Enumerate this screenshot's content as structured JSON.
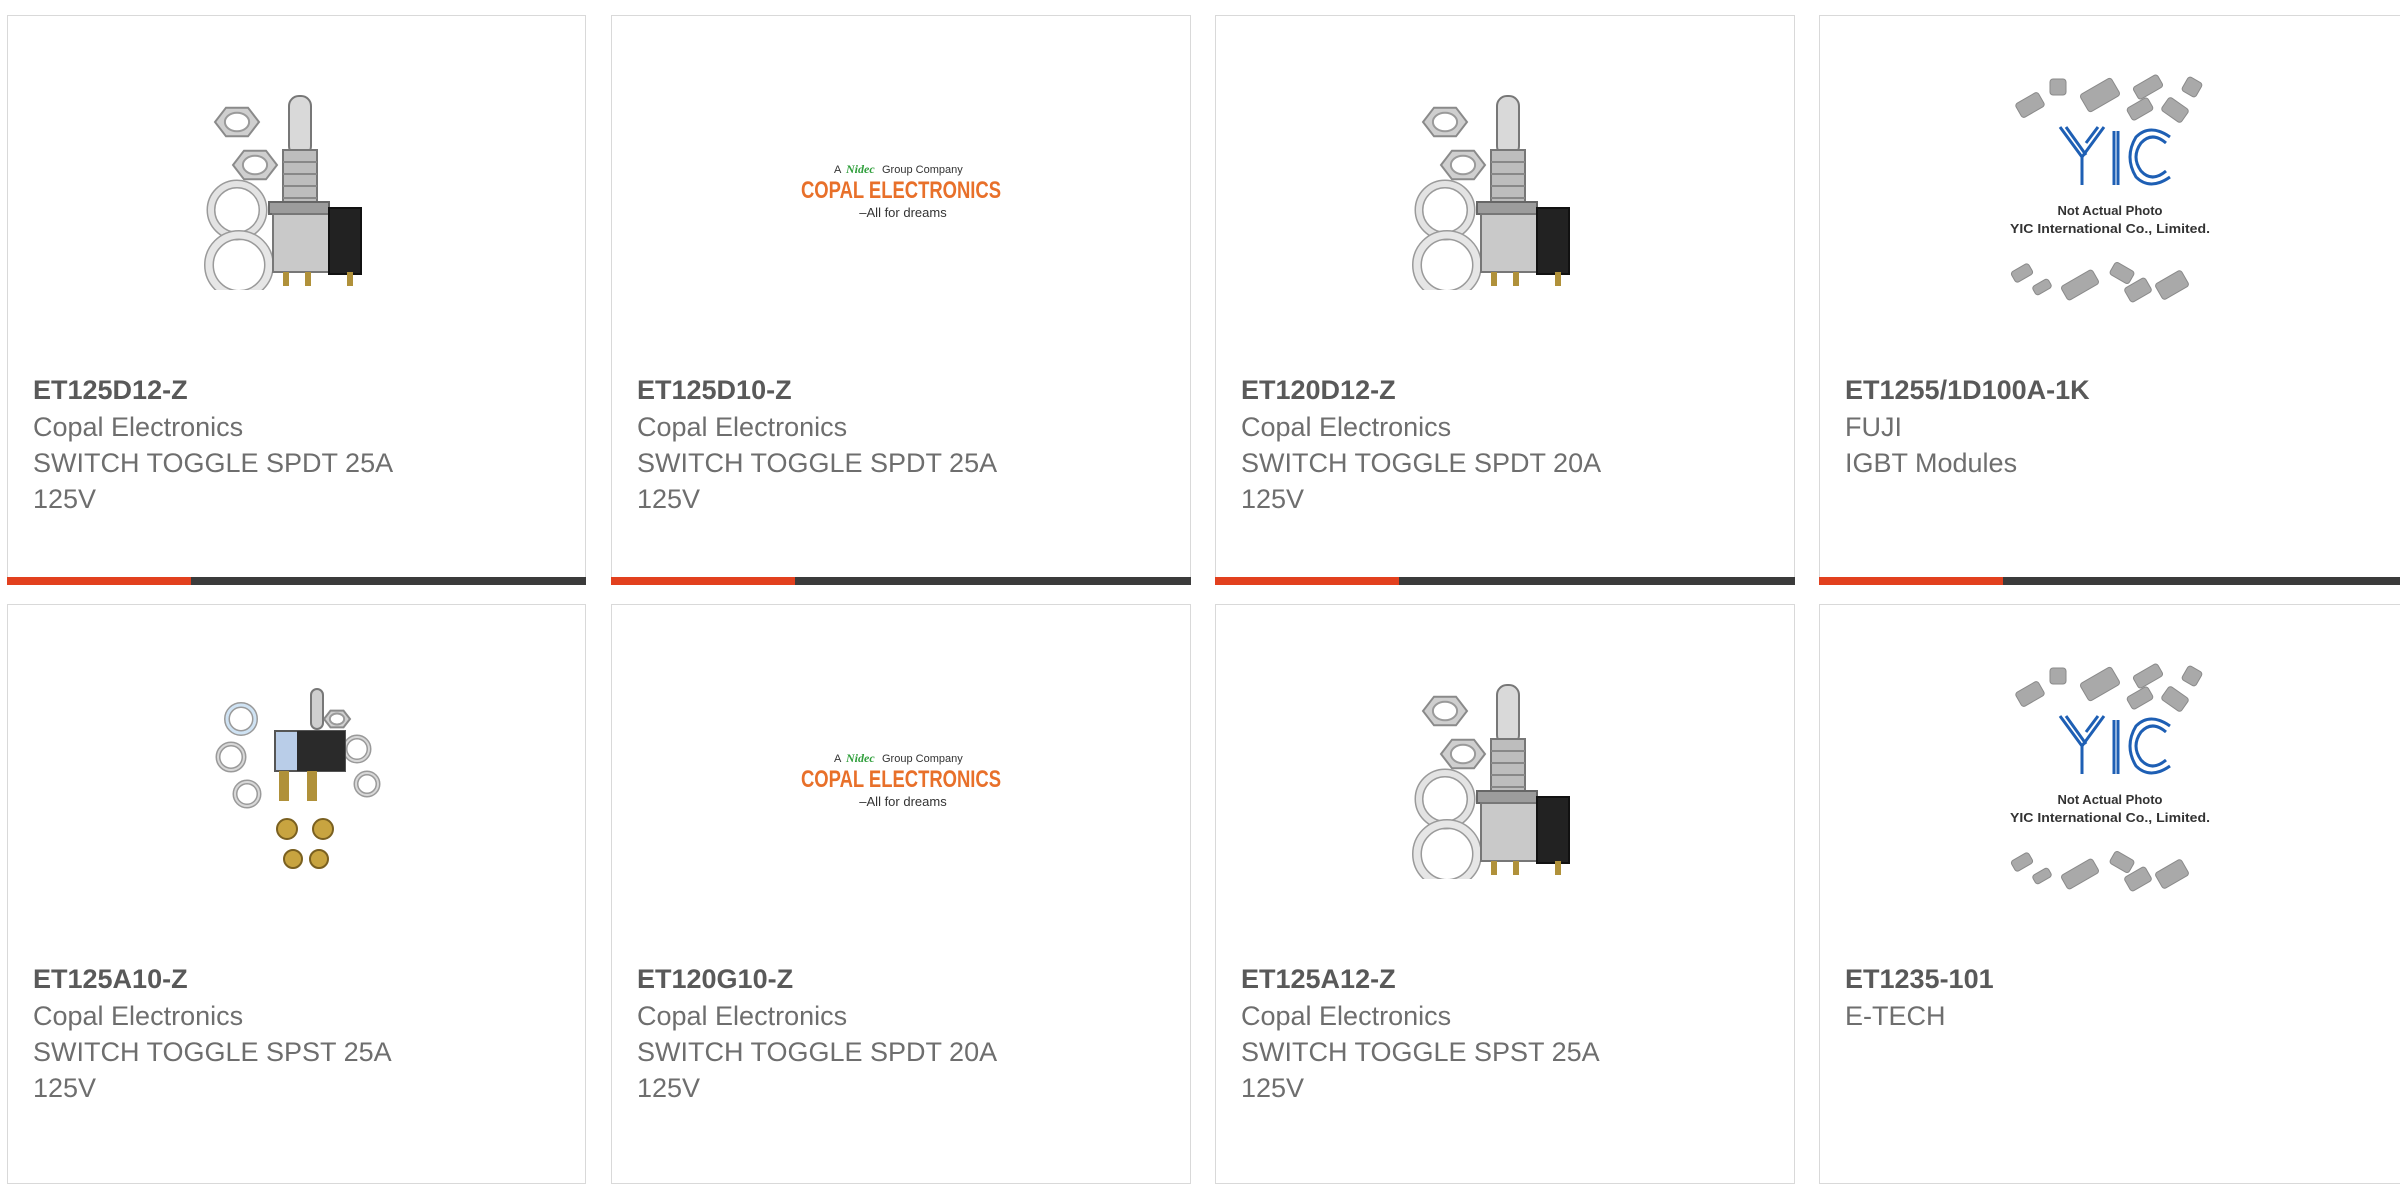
{
  "brand_colors": {
    "accent": "#e2401e",
    "bar": "#3b3b3b",
    "part_number": "#595959",
    "secondary_text": "#6e6e6e",
    "copal_orange": "#e8702a",
    "nidec_green": "#2e9e3a",
    "yic_blue": "#1e5fb4"
  },
  "products": [
    {
      "image_type": "toggle-switch-with-hardware",
      "part_number": "ET125D12-Z",
      "manufacturer": "Copal Electronics",
      "description": "SWITCH TOGGLE SPDT 25A\n125V"
    },
    {
      "image_type": "copal-logo",
      "part_number": "ET125D10-Z",
      "manufacturer": "Copal Electronics",
      "description": "SWITCH TOGGLE SPDT 25A\n125V"
    },
    {
      "image_type": "toggle-switch-with-hardware",
      "part_number": "ET120D12-Z",
      "manufacturer": "Copal Electronics",
      "description": "SWITCH TOGGLE SPDT 20A\n125V"
    },
    {
      "image_type": "yic-placeholder",
      "part_number": "ET1255/1D100A-1K",
      "manufacturer": "FUJI",
      "description": "IGBT Modules"
    },
    {
      "image_type": "toggle-switch-kit",
      "part_number": "ET125A10-Z",
      "manufacturer": "Copal Electronics",
      "description": "SWITCH TOGGLE SPST 25A\n125V"
    },
    {
      "image_type": "copal-logo",
      "part_number": "ET120G10-Z",
      "manufacturer": "Copal Electronics",
      "description": "SWITCH TOGGLE SPDT 20A\n125V"
    },
    {
      "image_type": "toggle-switch-with-hardware",
      "part_number": "ET125A12-Z",
      "manufacturer": "Copal Electronics",
      "description": "SWITCH TOGGLE SPST 25A\n125V"
    },
    {
      "image_type": "yic-placeholder",
      "part_number": "ET1235-101",
      "manufacturer": "E-TECH",
      "description": ""
    }
  ],
  "logo_text": {
    "copal_line1_a": "A",
    "copal_line1_brand": "Nidec",
    "copal_line1_b": "Group Company",
    "copal_name": "COPAL ELECTRONICS",
    "copal_tagline": "–All for dreams",
    "yic_mark": "YIC",
    "yic_line1": "Not Actual Photo",
    "yic_line2": "YIC International Co., Limited."
  }
}
